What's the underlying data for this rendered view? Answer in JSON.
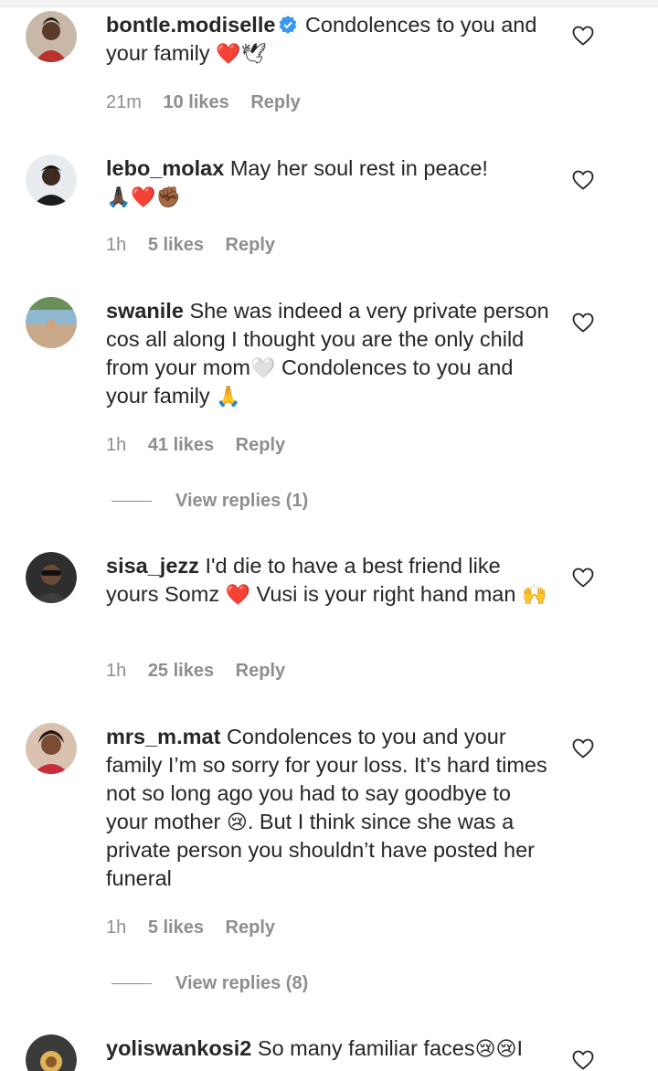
{
  "comments": [
    {
      "username": "bontle.modiselle",
      "verified": true,
      "text": "Condolences to you and your family",
      "emojis": "❤️🕊",
      "time": "21m",
      "likes": "10 likes",
      "reply": "Reply"
    },
    {
      "username": "lebo_molax",
      "text": "May her soul rest in peace!",
      "emojis": "🙏🏿❤️✊🏾",
      "time": "1h",
      "likes": "5 likes",
      "reply": "Reply"
    },
    {
      "username": "swanile",
      "text_a": "She was indeed a very private person cos all along I thought you are the only child from your mom",
      "emoji_a": "🤍",
      "text_b": "Condolences to you and your family",
      "emoji_b": "🙏",
      "time": "1h",
      "likes": "41 likes",
      "reply": "Reply",
      "view_replies": "View replies (1)"
    },
    {
      "username": "sisa_jezz",
      "text_a": "I'd die to have a best friend like yours Somz",
      "emoji_a": "❤️",
      "text_b": "Vusi is your right hand man",
      "emoji_b": "🙌",
      "time": "1h",
      "likes": "25 likes",
      "reply": "Reply"
    },
    {
      "username": "mrs_m.mat",
      "text_a": "Condolences to you and your family I’m so sorry for your loss. It’s hard times not so long ago you had to say goodbye to your mother",
      "emoji_a": "😢",
      "text_b": ". But I think since she was a private person you shouldn’t have posted her funeral",
      "time": "1h",
      "likes": "5 likes",
      "reply": "Reply",
      "view_replies": "View replies (8)"
    },
    {
      "username": "yoliswankosi2",
      "text_a": "So many familiar faces",
      "emoji_a": "😢😢",
      "text_b": "I"
    }
  ],
  "icons": {
    "like": "heart-outline-icon",
    "verified": "verified-badge-icon"
  },
  "colors": {
    "text": "#262626",
    "secondary": "#8e8e8e",
    "verified": "#3897f0"
  }
}
